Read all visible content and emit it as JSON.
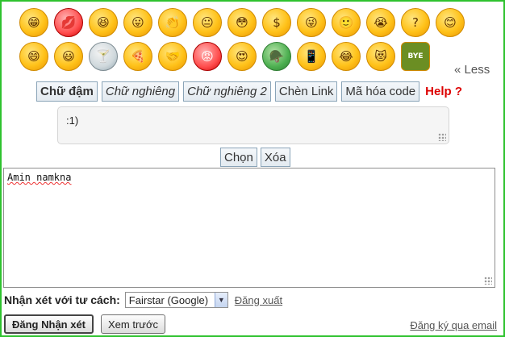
{
  "emoticons_row1": [
    "grin-icon",
    "lips-icon",
    "clap-face-icon",
    "tongue-icon",
    "clapping-hands-icon",
    "yellow-face-icon",
    "blush-icon",
    "dollar-eyes-icon",
    "wink-icon",
    "smile-icon",
    "crying-icon",
    "question-icon",
    "shy-icon"
  ],
  "emoticons_row2": [
    "cheer-icon",
    "big-grin-icon",
    "cocktail-icon",
    "pizza-icon",
    "handshake-icon",
    "hot-face-icon",
    "love-face-icon",
    "soldier-icon",
    "phone-face-icon",
    "laugh-icon",
    "heart-eyes-icon",
    "bye-icon"
  ],
  "less_label": "« Less",
  "format_buttons": {
    "bold": "Chữ đậm",
    "italic": "Chữ nghiêng",
    "italic2": "Chữ nghiêng 2",
    "link": "Chèn Link",
    "code": "Mã hóa code"
  },
  "help_label": "Help ?",
  "snippet_text": ":1)",
  "select_buttons": {
    "choose": "Chọn",
    "delete": "Xóa"
  },
  "comment_text": "Amin namkna",
  "identity": {
    "label": "Nhận xét với tư cách:",
    "selected": "Fairstar (Google)",
    "logout": "Đăng xuất"
  },
  "actions": {
    "publish": "Đăng Nhận xét",
    "preview": "Xem trước"
  },
  "subscribe": "Đăng ký qua email",
  "colors": {
    "frame": "#2ec22e",
    "help": "#dd0000"
  }
}
